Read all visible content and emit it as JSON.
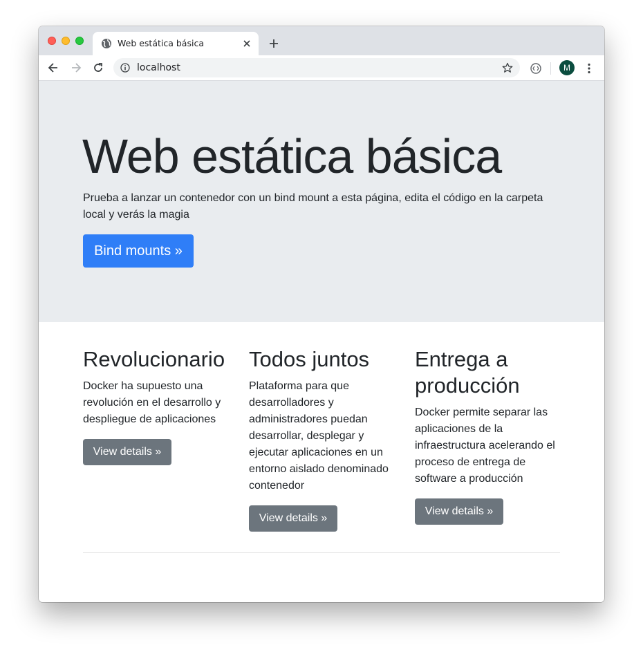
{
  "browser": {
    "tab_title": "Web estática básica",
    "url": "localhost",
    "avatar_initial": "M"
  },
  "jumbotron": {
    "title": "Web estática básica",
    "lead": "Prueba a lanzar un contenedor con un bind mount a esta página, edita el código en la carpeta local y verás la magia",
    "button_label": "Bind mounts »"
  },
  "columns": [
    {
      "heading": "Revolucionario",
      "text": "Docker ha supuesto una revolución en el desarrollo y despliegue de aplicaciones",
      "button_label": "View details »"
    },
    {
      "heading": "Todos juntos",
      "text": "Plataforma para que desarrolladores y administradores puedan desarrollar, desplegar y ejecutar aplicaciones en un entorno aislado denominado contenedor",
      "button_label": "View details »"
    },
    {
      "heading": "Entrega a producción",
      "text": "Docker permite separar las aplicaciones de la infraestructura acelerando el proceso de entrega de software a producción",
      "button_label": "View details »"
    }
  ],
  "colors": {
    "primary": "#2f7ef7",
    "secondary": "#6c757d",
    "jumbotron_bg": "#e9ecef",
    "avatar_bg": "#0b4d3f"
  }
}
